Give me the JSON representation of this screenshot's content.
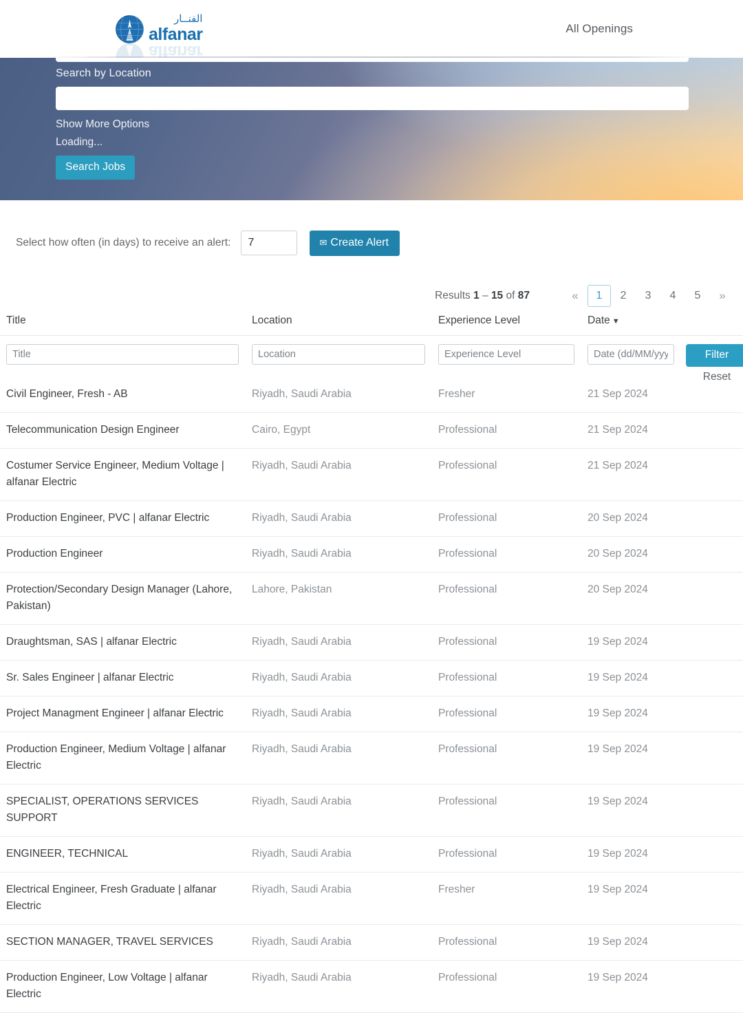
{
  "header": {
    "logo_arabic": "الفنــار",
    "logo_latin": "alfanar",
    "nav": [
      {
        "label": "All Openings",
        "name": "nav-all-openings"
      }
    ]
  },
  "hero": {
    "location_label": "Search by Location",
    "location_value": "",
    "location_placeholder": "",
    "show_more_options": "Show More Options",
    "loading_text": "Loading...",
    "search_button": "Search Jobs",
    "accent_button_color": "#2b9dbe"
  },
  "alert": {
    "label": "Select how often (in days) to receive an alert:",
    "days_value": "7",
    "create_button": "Create Alert",
    "envelope_icon": "✉",
    "button_color": "#2183ab"
  },
  "pagination": {
    "results_prefix": "Results",
    "range_start": "1",
    "range_dash": "–",
    "range_end": "15",
    "of_word": "of",
    "total": "87",
    "prev_label": "«",
    "next_label": "»",
    "pages": [
      "1",
      "2",
      "3",
      "4",
      "5"
    ],
    "active_page": "1",
    "active_color": "#3f9dc4"
  },
  "table": {
    "headers": [
      {
        "label": "Title",
        "name": "col-title"
      },
      {
        "label": "Location",
        "name": "col-location"
      },
      {
        "label": "Experience Level",
        "name": "col-experience"
      },
      {
        "label": "Date",
        "name": "col-date"
      }
    ],
    "sort_caret": "▼",
    "sorted_column": "Date",
    "filters": {
      "title_placeholder": "Title",
      "title_value": "",
      "location_placeholder": "Location",
      "location_value": "",
      "experience_placeholder": "Experience Level",
      "experience_value": "",
      "date_placeholder": "Date (dd/MM/yyyy)",
      "date_value": "",
      "filter_button": "Filter",
      "reset_link": "Reset",
      "filter_button_color": "#2b9ec3"
    },
    "rows": [
      {
        "title": "Civil Engineer, Fresh - AB",
        "location": "Riyadh, Saudi Arabia",
        "experience": "Fresher",
        "date": "21 Sep 2024"
      },
      {
        "title": "Telecommunication Design Engineer",
        "location": "Cairo, Egypt",
        "experience": "Professional",
        "date": "21 Sep 2024"
      },
      {
        "title": "Costumer Service Engineer, Medium Voltage | alfanar Electric",
        "location": "Riyadh, Saudi Arabia",
        "experience": "Professional",
        "date": "21 Sep 2024"
      },
      {
        "title": "Production Engineer, PVC | alfanar Electric",
        "location": "Riyadh, Saudi Arabia",
        "experience": "Professional",
        "date": "20 Sep 2024"
      },
      {
        "title": "Production Engineer",
        "location": "Riyadh, Saudi Arabia",
        "experience": "Professional",
        "date": "20 Sep 2024"
      },
      {
        "title": "Protection/Secondary Design Manager (Lahore, Pakistan)",
        "location": "Lahore, Pakistan",
        "experience": "Professional",
        "date": "20 Sep 2024"
      },
      {
        "title": "Draughtsman, SAS | alfanar Electric",
        "location": "Riyadh, Saudi Arabia",
        "experience": "Professional",
        "date": "19 Sep 2024"
      },
      {
        "title": "Sr. Sales Engineer | alfanar Electric",
        "location": "Riyadh, Saudi Arabia",
        "experience": "Professional",
        "date": "19 Sep 2024"
      },
      {
        "title": "Project Managment Engineer | alfanar Electric",
        "location": "Riyadh, Saudi Arabia",
        "experience": "Professional",
        "date": "19 Sep 2024"
      },
      {
        "title": "Production Engineer, Medium Voltage | alfanar Electric",
        "location": "Riyadh, Saudi Arabia",
        "experience": "Professional",
        "date": "19 Sep 2024"
      },
      {
        "title": "SPECIALIST, OPERATIONS SERVICES SUPPORT",
        "location": "Riyadh, Saudi Arabia",
        "experience": "Professional",
        "date": "19 Sep 2024"
      },
      {
        "title": "ENGINEER, TECHNICAL",
        "location": "Riyadh, Saudi Arabia",
        "experience": "Professional",
        "date": "19 Sep 2024"
      },
      {
        "title": "Electrical Engineer, Fresh Graduate | alfanar Electric",
        "location": "Riyadh, Saudi Arabia",
        "experience": "Fresher",
        "date": "19 Sep 2024"
      },
      {
        "title": "SECTION MANAGER, TRAVEL SERVICES",
        "location": "Riyadh, Saudi Arabia",
        "experience": "Professional",
        "date": "19 Sep 2024"
      },
      {
        "title": "Production Engineer, Low Voltage | alfanar Electric",
        "location": "Riyadh, Saudi Arabia",
        "experience": "Professional",
        "date": "19 Sep 2024"
      }
    ]
  }
}
